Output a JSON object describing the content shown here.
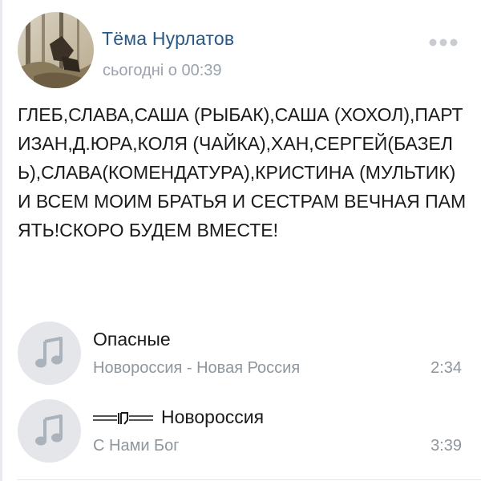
{
  "post": {
    "author": "Тёма Нурлатов",
    "date": "сьогодні о 00:39",
    "text": "ГЛЕБ,СЛАВА,САША (РЫБАК),САША (ХОХОЛ),ПАРТИЗАН,Д.ЮРА,КОЛЯ (ЧАЙКА),ХАН,СЕРГЕЙ(БАЗЕЛЬ),СЛАВА(КОМЕНДАТУРА),КРИСТИНА (МУЛЬТИК) И ВСЕМ МОИМ БРАТЬЯ И СЕСТРАМ ВЕЧНАЯ ПАМЯТЬ!СКОРО БУДЕМ ВМЕСТЕ!"
  },
  "icons": {
    "more": "more-dots-icon",
    "note": "music-note-icon",
    "title_logo": "cross-emblem-icon"
  },
  "audio": [
    {
      "title": "Опасные",
      "artist": "Новороссия - Новая Россия",
      "duration": "2:34"
    },
    {
      "title": "Новороссия",
      "artist": "С Нами Бог",
      "duration": "3:39"
    }
  ],
  "colors": {
    "author": "#2a5885",
    "meta": "#9aa3ad",
    "play_bg": "#e4e6ea",
    "note": "#aab2bc"
  }
}
